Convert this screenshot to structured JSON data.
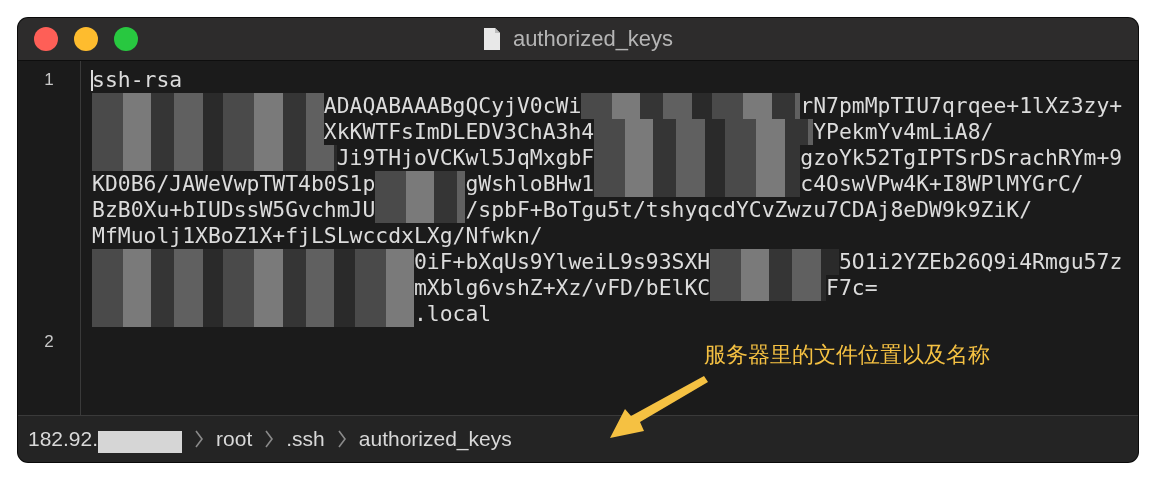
{
  "window": {
    "title": "authorized_keys"
  },
  "editor": {
    "lines": [
      {
        "number": "1",
        "cursor": true,
        "rows": [
          [
            {
              "kind": "text",
              "text": "ssh-rsa"
            }
          ],
          [
            {
              "kind": "redacted"
            },
            {
              "kind": "text",
              "text": "ADAQABAAABgQCyjV0cWi"
            },
            {
              "kind": "redacted"
            },
            {
              "kind": "text",
              "text": "rN7pmMpTIU7qrqee+1lXz3zy+"
            }
          ],
          [
            {
              "kind": "redacted"
            },
            {
              "kind": "text",
              "text": "XkKWTFsImDLEDV3ChA3h4"
            },
            {
              "kind": "redacted"
            },
            {
              "kind": "text",
              "text": "YPekmYv4mLiA8/"
            }
          ],
          [
            {
              "kind": "redacted"
            },
            {
              "kind": "text",
              "text": "Ji9THjoVCKwl5JqMxgbF"
            },
            {
              "kind": "redacted"
            },
            {
              "kind": "text",
              "text": "gzoYk52TgIPTSrDSrachRYm+9"
            }
          ],
          [
            {
              "kind": "text",
              "text": "KD0B6/JAWeVwpTWT4b0S1p"
            },
            {
              "kind": "redacted"
            },
            {
              "kind": "text",
              "text": "gWshloBHw1"
            },
            {
              "kind": "redacted"
            },
            {
              "kind": "text",
              "text": "c4OswVPw4K+I8WPlMYGrC/"
            }
          ],
          [
            {
              "kind": "text",
              "text": "BzB0Xu+bIUDssW5GvchmJU"
            },
            {
              "kind": "redacted"
            },
            {
              "kind": "text",
              "text": "/spbF+BoTgu5t/tshyqcdYCvZwzu7CDAj8eDW9k9ZiK/"
            }
          ],
          [
            {
              "kind": "text",
              "text": "MfMuolj1XBoZ1X+fjLSLwccdxLXg/Nfwkn/"
            }
          ],
          [
            {
              "kind": "redacted"
            },
            {
              "kind": "text",
              "text": "0iF+bXqUs9YlweiL9s93SXH"
            },
            {
              "kind": "redacted"
            },
            {
              "kind": "text",
              "text": "5O1i2YZEb26Q9i4Rmgu57z"
            }
          ],
          [
            {
              "kind": "redacted"
            },
            {
              "kind": "text",
              "text": "mXblg6vshZ+Xz/vFD/bElKC"
            },
            {
              "kind": "redacted"
            },
            {
              "kind": "text",
              "text": "F7c="
            }
          ],
          [
            {
              "kind": "redacted"
            },
            {
              "kind": "text",
              "text": ".local"
            }
          ]
        ]
      },
      {
        "number": "2",
        "cursor": false
      }
    ]
  },
  "annotation": {
    "text": "服务器里的文件位置以及名称"
  },
  "status_bar": {
    "breadcrumbs": [
      {
        "segments": [
          {
            "kind": "text",
            "text": "182.92."
          },
          {
            "kind": "redacted"
          }
        ]
      },
      {
        "segments": [
          {
            "kind": "text",
            "text": "root"
          }
        ]
      },
      {
        "segments": [
          {
            "kind": "text",
            "text": ".ssh"
          }
        ]
      },
      {
        "segments": [
          {
            "kind": "text",
            "text": "authorized_keys"
          }
        ]
      }
    ]
  }
}
